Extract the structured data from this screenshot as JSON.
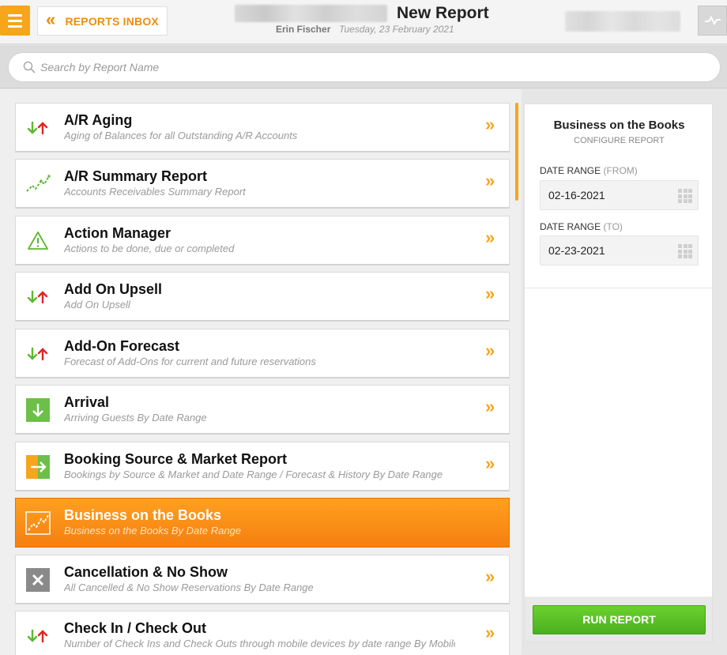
{
  "header": {
    "inbox_label": "REPORTS INBOX",
    "title": "New Report",
    "user": "Erin Fischer",
    "date": "Tuesday, 23 February 2021"
  },
  "search": {
    "placeholder": "Search by Report Name"
  },
  "reports": [
    {
      "title": "A/R Aging",
      "subtitle": "Aging of Balances for all Outstanding A/R Accounts",
      "icon": "up-down-arrows-icon"
    },
    {
      "title": "A/R Summary Report",
      "subtitle": "Accounts Receivables Summary Report",
      "icon": "trend-line-icon"
    },
    {
      "title": "Action Manager",
      "subtitle": "Actions to be done, due or completed",
      "icon": "warning-icon"
    },
    {
      "title": "Add On Upsell",
      "subtitle": "Add On Upsell",
      "icon": "up-down-arrows-icon"
    },
    {
      "title": "Add-On Forecast",
      "subtitle": "Forecast of Add-Ons for current and future reservations",
      "icon": "up-down-arrows-icon"
    },
    {
      "title": "Arrival",
      "subtitle": "Arriving Guests By Date Range",
      "icon": "arrival-icon"
    },
    {
      "title": "Booking Source & Market Report",
      "subtitle": "Bookings by Source & Market and Date Range / Forecast & History By Date Range",
      "icon": "split-arrow-icon"
    },
    {
      "title": "Business on the Books",
      "subtitle": "Business on the Books By Date Range",
      "icon": "trend-line-icon",
      "selected": true
    },
    {
      "title": "Cancellation & No Show",
      "subtitle": "All Cancelled & No Show Reservations By Date Range",
      "icon": "cancel-icon"
    },
    {
      "title": "Check In / Check Out",
      "subtitle": "Number of Check Ins and Check Outs through mobile devices by date range By Mobile",
      "icon": "up-down-arrows-icon"
    }
  ],
  "config": {
    "title": "Business on the Books",
    "subtitle": "CONFIGURE REPORT",
    "from_label": "DATE RANGE",
    "from_paren": "(FROM)",
    "from_value": "02-16-2021",
    "to_label": "DATE RANGE",
    "to_paren": "(TO)",
    "to_value": "02-23-2021",
    "run_label": "RUN REPORT"
  },
  "colors": {
    "accent": "#f7a51c",
    "selected": "#f88f14",
    "run_green": "#5cc326",
    "arrow_down": "#5cb82e",
    "arrow_up": "#e02424"
  }
}
